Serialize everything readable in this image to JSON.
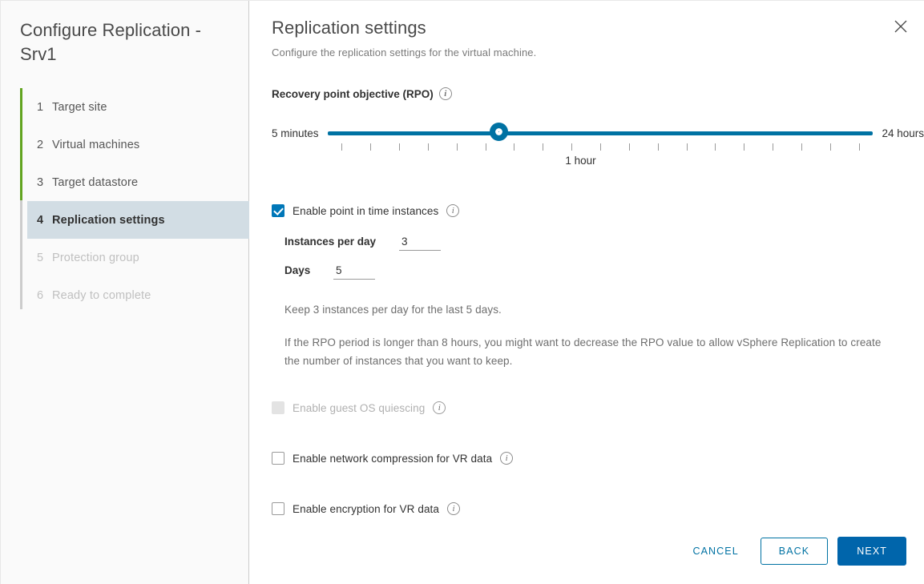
{
  "wizard": {
    "title": "Configure Replication - Srv1",
    "steps": [
      {
        "num": "1",
        "label": "Target site",
        "state": "done"
      },
      {
        "num": "2",
        "label": "Virtual machines",
        "state": "done"
      },
      {
        "num": "3",
        "label": "Target datastore",
        "state": "done"
      },
      {
        "num": "4",
        "label": "Replication settings",
        "state": "active"
      },
      {
        "num": "5",
        "label": "Protection group",
        "state": "disabled"
      },
      {
        "num": "6",
        "label": "Ready to complete",
        "state": "disabled"
      }
    ]
  },
  "panel": {
    "title": "Replication settings",
    "subtitle": "Configure the replication settings for the virtual machine.",
    "close_icon": "close-icon"
  },
  "rpo": {
    "label": "Recovery point objective (RPO)",
    "info_icon": "info-icon",
    "min_label": "5 minutes",
    "max_label": "24 hours",
    "current_label": "1 hour",
    "thumb_percent": 31.4,
    "tick_count": 19,
    "accent_color": "#0072a3"
  },
  "pit": {
    "checkbox_label": "Enable point in time instances",
    "checked": true,
    "info_icon": "info-icon",
    "instances_label": "Instances per day",
    "instances_value": "3",
    "days_label": "Days",
    "days_value": "5",
    "summary": "Keep 3 instances per day for the last 5 days.",
    "note": "If the RPO period is longer than 8 hours, you might want to decrease the RPO value to allow vSphere Replication to create the number of instances that you want to keep."
  },
  "options": [
    {
      "label": "Enable guest OS quiescing",
      "checked": false,
      "disabled": true,
      "info_icon": "info-icon"
    },
    {
      "label": "Enable network compression for VR data",
      "checked": false,
      "disabled": false,
      "info_icon": "info-icon"
    },
    {
      "label": "Enable encryption for VR data",
      "checked": false,
      "disabled": false,
      "info_icon": "info-icon"
    }
  ],
  "footer": {
    "cancel": "CANCEL",
    "back": "BACK",
    "next": "NEXT"
  },
  "colors": {
    "accent_blue": "#0072a3",
    "primary_blue": "#0065ab",
    "checkbox_blue": "#0077b8",
    "done_green": "#62a420",
    "active_step_bg": "#d2dde4"
  }
}
